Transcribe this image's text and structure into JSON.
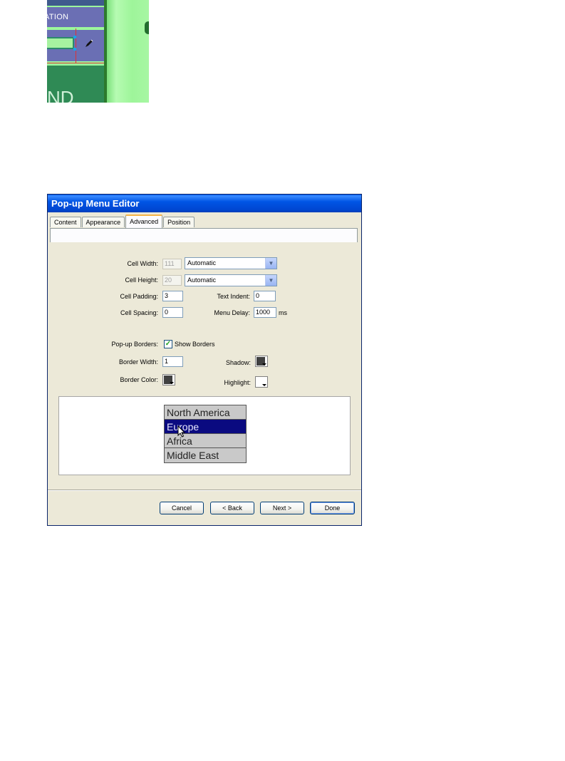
{
  "top_crop": {
    "nav_text": "ATION",
    "bottom_text": "ND"
  },
  "dialog": {
    "title": "Pop-up Menu Editor",
    "tabs": [
      {
        "label": "Content",
        "active": false
      },
      {
        "label": "Appearance",
        "active": false
      },
      {
        "label": "Advanced",
        "active": true
      },
      {
        "label": "Position",
        "active": false
      }
    ],
    "fields": {
      "cell_width_label": "Cell Width:",
      "cell_width_value": "111",
      "cell_width_mode": "Automatic",
      "cell_height_label": "Cell Height:",
      "cell_height_value": "20",
      "cell_height_mode": "Automatic",
      "cell_padding_label": "Cell Padding:",
      "cell_padding_value": "3",
      "text_indent_label": "Text Indent:",
      "text_indent_value": "0",
      "cell_spacing_label": "Cell Spacing:",
      "cell_spacing_value": "0",
      "menu_delay_label": "Menu Delay:",
      "menu_delay_value": "1000",
      "menu_delay_unit": "ms",
      "popup_borders_label": "Pop-up Borders:",
      "show_borders_label": "Show Borders",
      "show_borders_checked": true,
      "border_width_label": "Border Width:",
      "border_width_value": "1",
      "shadow_label": "Shadow:",
      "border_color_label": "Border Color:",
      "highlight_label": "Highlight:"
    },
    "colors": {
      "shadow": "#404040",
      "border_color": "#404040",
      "highlight": "#ffffff"
    },
    "preview_menu": [
      {
        "label": "North America",
        "highlighted": false
      },
      {
        "label": "Europe",
        "highlighted": true
      },
      {
        "label": "Africa",
        "highlighted": false
      },
      {
        "label": "Middle East",
        "highlighted": false
      }
    ],
    "buttons": {
      "cancel": "Cancel",
      "back": "< Back",
      "next": "Next >",
      "done": "Done"
    }
  }
}
